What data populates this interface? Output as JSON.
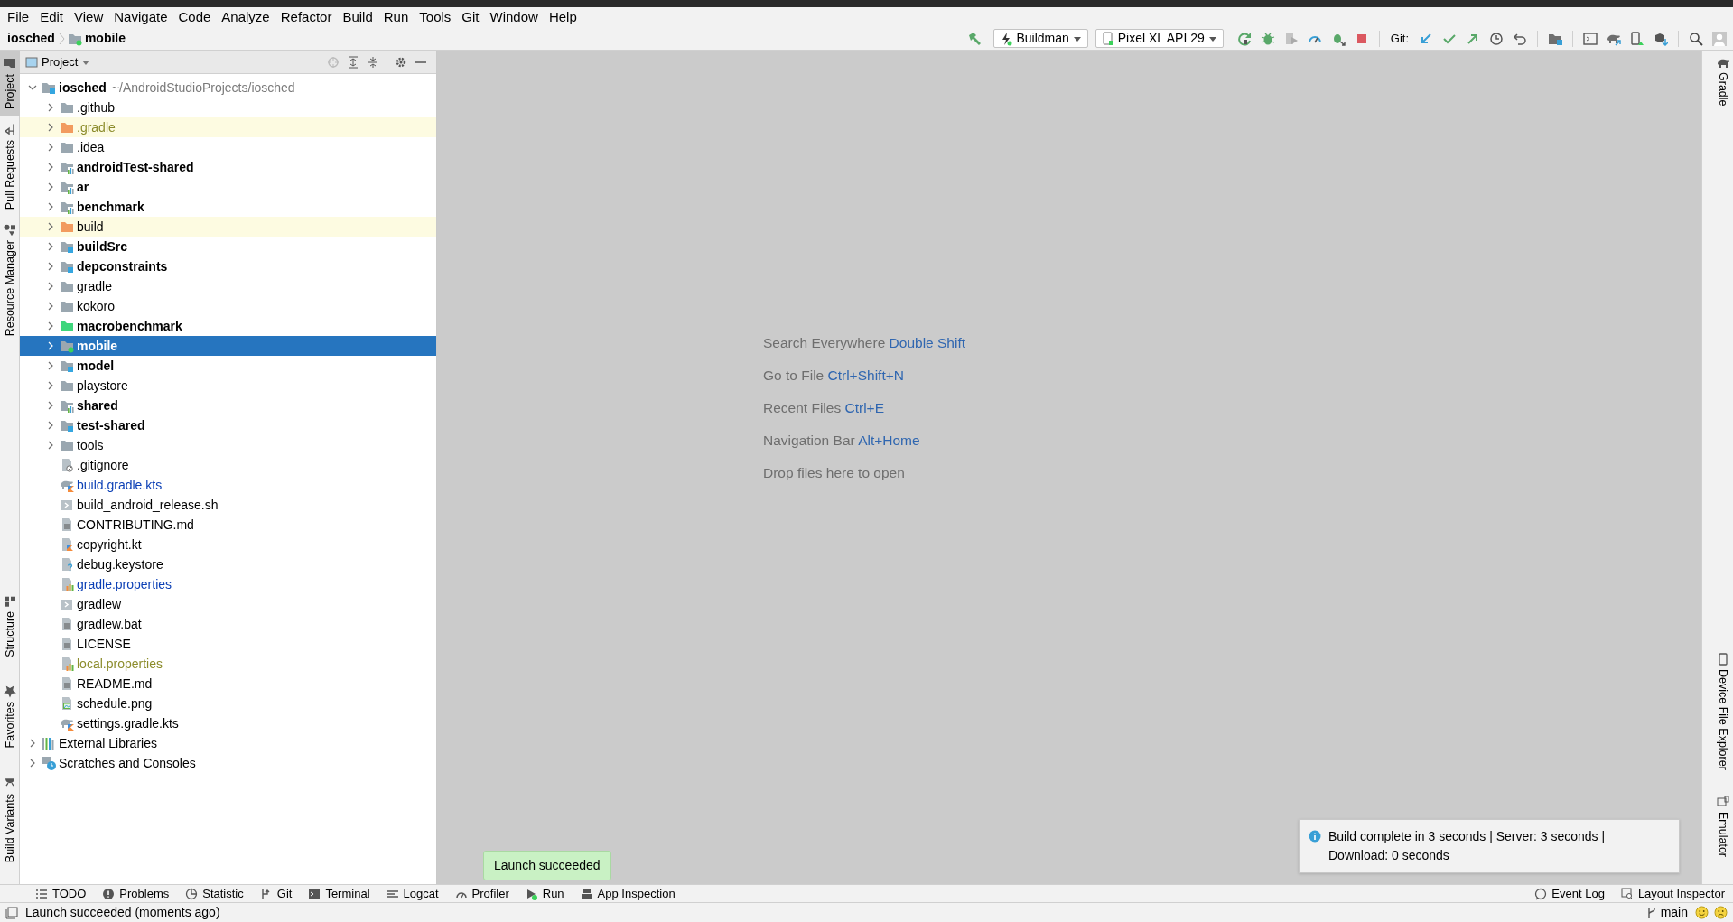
{
  "menu": [
    "File",
    "Edit",
    "View",
    "Navigate",
    "Code",
    "Analyze",
    "Refactor",
    "Build",
    "Run",
    "Tools",
    "Git",
    "Window",
    "Help"
  ],
  "breadcrumb": [
    "iosched",
    "mobile"
  ],
  "toolbar": {
    "run_config": "Buildman",
    "device": "Pixel XL API 29",
    "git_label": "Git:"
  },
  "left_stripe_top": [
    {
      "label": "Project",
      "selected": true
    },
    {
      "label": "Pull Requests",
      "selected": false
    },
    {
      "label": "Resource Manager",
      "selected": false
    }
  ],
  "left_stripe_bottom": [
    {
      "label": "Structure",
      "selected": false
    },
    {
      "label": "Favorites",
      "selected": false
    },
    {
      "label": "Build Variants",
      "selected": false
    }
  ],
  "project_panel": {
    "title": "Project"
  },
  "tree": [
    {
      "label": "iosched",
      "path": "~/AndroidStudioProjects/iosched",
      "kind": "module",
      "expanded": true,
      "selected": false,
      "highlighted": false,
      "modified": false,
      "ignored": false,
      "children": [
        {
          "label": ".github",
          "kind": "folder",
          "expanded": false,
          "selected": false,
          "highlighted": false,
          "modified": false,
          "ignored": false
        },
        {
          "label": ".gradle",
          "kind": "excluded",
          "expanded": false,
          "selected": false,
          "highlighted": true,
          "modified": false,
          "ignored": true
        },
        {
          "label": ".idea",
          "kind": "folder",
          "expanded": false,
          "selected": false,
          "highlighted": false,
          "modified": false,
          "ignored": false
        },
        {
          "label": "androidTest-shared",
          "kind": "android-module",
          "expanded": false,
          "selected": false,
          "highlighted": false,
          "modified": false,
          "ignored": false
        },
        {
          "label": "ar",
          "kind": "android-module",
          "expanded": false,
          "selected": false,
          "highlighted": false,
          "modified": false,
          "ignored": false
        },
        {
          "label": "benchmark",
          "kind": "android-module",
          "expanded": false,
          "selected": false,
          "highlighted": false,
          "modified": false,
          "ignored": false
        },
        {
          "label": "build",
          "kind": "excluded",
          "expanded": false,
          "selected": false,
          "highlighted": true,
          "modified": false,
          "ignored": false
        },
        {
          "label": "buildSrc",
          "kind": "module",
          "expanded": false,
          "selected": false,
          "highlighted": false,
          "modified": false,
          "ignored": false
        },
        {
          "label": "depconstraints",
          "kind": "module",
          "expanded": false,
          "selected": false,
          "highlighted": false,
          "modified": false,
          "ignored": false
        },
        {
          "label": "gradle",
          "kind": "folder",
          "expanded": false,
          "selected": false,
          "highlighted": false,
          "modified": false,
          "ignored": false
        },
        {
          "label": "kokoro",
          "kind": "folder",
          "expanded": false,
          "selected": false,
          "highlighted": false,
          "modified": false,
          "ignored": false
        },
        {
          "label": "macrobenchmark",
          "kind": "test-module",
          "expanded": false,
          "selected": false,
          "highlighted": false,
          "modified": false,
          "ignored": false
        },
        {
          "label": "mobile",
          "kind": "app-module",
          "expanded": false,
          "selected": true,
          "highlighted": false,
          "modified": false,
          "ignored": false
        },
        {
          "label": "model",
          "kind": "module",
          "expanded": false,
          "selected": false,
          "highlighted": false,
          "modified": false,
          "ignored": false
        },
        {
          "label": "playstore",
          "kind": "folder",
          "expanded": false,
          "selected": false,
          "highlighted": false,
          "modified": false,
          "ignored": false
        },
        {
          "label": "shared",
          "kind": "android-module",
          "expanded": false,
          "selected": false,
          "highlighted": false,
          "modified": false,
          "ignored": false
        },
        {
          "label": "test-shared",
          "kind": "module",
          "expanded": false,
          "selected": false,
          "highlighted": false,
          "modified": false,
          "ignored": false
        },
        {
          "label": "tools",
          "kind": "folder",
          "expanded": false,
          "selected": false,
          "highlighted": false,
          "modified": false,
          "ignored": false
        },
        {
          "label": ".gitignore",
          "kind": "ignore-file",
          "selected": false,
          "highlighted": false,
          "modified": false,
          "ignored": false
        },
        {
          "label": "build.gradle.kts",
          "kind": "gradle-file",
          "selected": false,
          "highlighted": false,
          "modified": true,
          "ignored": false
        },
        {
          "label": "build_android_release.sh",
          "kind": "script-file",
          "selected": false,
          "highlighted": false,
          "modified": false,
          "ignored": false
        },
        {
          "label": "CONTRIBUTING.md",
          "kind": "text-file",
          "selected": false,
          "highlighted": false,
          "modified": false,
          "ignored": false
        },
        {
          "label": "copyright.kt",
          "kind": "kotlin-file",
          "selected": false,
          "highlighted": false,
          "modified": false,
          "ignored": false
        },
        {
          "label": "debug.keystore",
          "kind": "unknown-file",
          "selected": false,
          "highlighted": false,
          "modified": false,
          "ignored": false
        },
        {
          "label": "gradle.properties",
          "kind": "properties-file",
          "selected": false,
          "highlighted": false,
          "modified": true,
          "ignored": false
        },
        {
          "label": "gradlew",
          "kind": "script-file",
          "selected": false,
          "highlighted": false,
          "modified": false,
          "ignored": false
        },
        {
          "label": "gradlew.bat",
          "kind": "text-file",
          "selected": false,
          "highlighted": false,
          "modified": false,
          "ignored": false
        },
        {
          "label": "LICENSE",
          "kind": "text-file",
          "selected": false,
          "highlighted": false,
          "modified": false,
          "ignored": false
        },
        {
          "label": "local.properties",
          "kind": "properties-file",
          "selected": false,
          "highlighted": false,
          "modified": false,
          "ignored": true
        },
        {
          "label": "README.md",
          "kind": "text-file",
          "selected": false,
          "highlighted": false,
          "modified": false,
          "ignored": false
        },
        {
          "label": "schedule.png",
          "kind": "image-file",
          "selected": false,
          "highlighted": false,
          "modified": false,
          "ignored": false
        },
        {
          "label": "settings.gradle.kts",
          "kind": "gradle-file",
          "selected": false,
          "highlighted": false,
          "modified": false,
          "ignored": false
        }
      ]
    },
    {
      "label": "External Libraries",
      "kind": "libraries",
      "expanded": false,
      "selected": false,
      "highlighted": false,
      "modified": false,
      "ignored": false
    },
    {
      "label": "Scratches and Consoles",
      "kind": "scratches",
      "expanded": false,
      "selected": false,
      "highlighted": false,
      "modified": false,
      "ignored": false
    }
  ],
  "editor_hints": [
    {
      "text": "Search Everywhere",
      "shortcut": "Double Shift"
    },
    {
      "text": "Go to File",
      "shortcut": "Ctrl+Shift+N"
    },
    {
      "text": "Recent Files",
      "shortcut": "Ctrl+E"
    },
    {
      "text": "Navigation Bar",
      "shortcut": "Alt+Home"
    },
    {
      "text": "Drop files here to open"
    }
  ],
  "right_stripe_top": [
    {
      "label": "Gradle"
    }
  ],
  "right_stripe_bottom": [
    {
      "label": "Device File Explorer"
    },
    {
      "label": "Emulator"
    }
  ],
  "notification": {
    "text": "Build complete in 3 seconds | Server: 3 seconds | Download: 0 seconds"
  },
  "tooltip": {
    "text": "Launch succeeded"
  },
  "tool_windows_left": [
    {
      "label": "TODO",
      "running": false
    },
    {
      "label": "Problems",
      "running": false
    },
    {
      "label": "Statistic",
      "running": false
    },
    {
      "label": "Git",
      "running": false
    },
    {
      "label": "Terminal",
      "running": false
    },
    {
      "label": "Logcat",
      "running": false
    },
    {
      "label": "Profiler",
      "running": false
    },
    {
      "label": "Run",
      "running": true
    },
    {
      "label": "App Inspection",
      "running": false
    }
  ],
  "tool_windows_right": [
    {
      "label": "Event Log"
    },
    {
      "label": "Layout Inspector"
    }
  ],
  "status_bar": {
    "message": "Launch succeeded (moments ago)",
    "branch": "main"
  }
}
